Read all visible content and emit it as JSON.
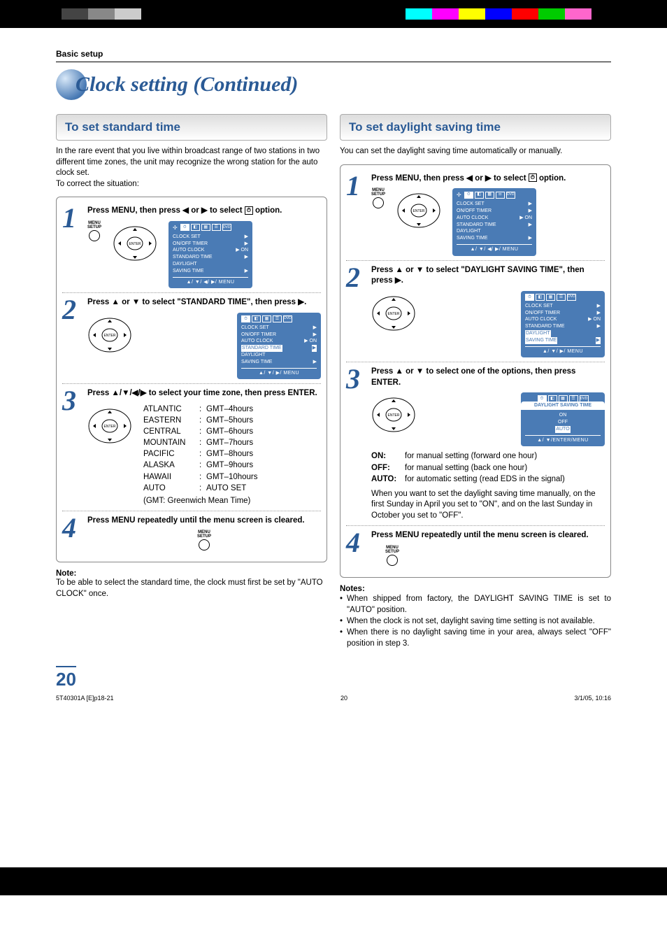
{
  "section_label": "Basic setup",
  "page_title": "Clock setting (Continued)",
  "page_number": "20",
  "footer": {
    "left": "5T40301A [E]p18-21",
    "center": "20",
    "right": "3/1/05, 10:16"
  },
  "left": {
    "subheading": "To set standard time",
    "intro": "In the rare event that you live within broadcast range of two stations in two different time zones, the unit may recognize the wrong station for the auto clock set.\nTo correct the situation:",
    "step1": {
      "instr_a": "Press MENU, then press ",
      "instr_b": " or ",
      "instr_c": " to select ",
      "instr_d": " option.",
      "menu_label": "MENU\nSETUP",
      "osd": {
        "rows": [
          [
            "CLOCK SET",
            "▶"
          ],
          [
            "ON/OFF TIMER",
            "▶"
          ],
          [
            "AUTO CLOCK",
            "▶ ON"
          ],
          [
            "STANDARD TIME",
            "▶"
          ],
          [
            "DAYLIGHT",
            ""
          ],
          [
            "      SAVING TIME",
            "▶"
          ]
        ],
        "foot": "▲/ ▼/ ◀/ ▶/ MENU"
      }
    },
    "step2": {
      "instr_a": "Press ",
      "instr_b": " or ",
      "instr_c": " to select \"STANDARD TIME\", then press ",
      "instr_d": ".",
      "osd": {
        "rows": [
          [
            "CLOCK SET",
            "▶"
          ],
          [
            "ON/OFF TIMER",
            "▶"
          ],
          [
            "AUTO CLOCK",
            "▶ ON"
          ],
          [
            "STANDARD TIME",
            "▶"
          ],
          [
            "DAYLIGHT",
            ""
          ],
          [
            "      SAVING TIME",
            "▶"
          ]
        ],
        "highlight_index": 3,
        "foot": "▲/ ▼/ ▶/ MENU"
      }
    },
    "step3": {
      "instr_a": "Press ",
      "instr_b": " to select your time zone, then press ENTER.",
      "tz": [
        [
          "ATLANTIC",
          "GMT–4hours"
        ],
        [
          "EASTERN",
          "GMT–5hours"
        ],
        [
          "CENTRAL",
          "GMT–6hours"
        ],
        [
          "MOUNTAIN",
          "GMT–7hours"
        ],
        [
          "PACIFIC",
          "GMT–8hours"
        ],
        [
          "ALASKA",
          "GMT–9hours"
        ],
        [
          "HAWAII",
          "GMT–10hours"
        ],
        [
          "AUTO",
          "AUTO SET"
        ]
      ],
      "tz_sub": "(GMT: Greenwich Mean Time)"
    },
    "step4": {
      "instr": "Press MENU repeatedly until the menu screen is cleared.",
      "menu_label": "MENU\nSETUP"
    },
    "note_head": "Note:",
    "note_body": "To be able to select the standard time, the clock must first be set by \"AUTO CLOCK\" once."
  },
  "right": {
    "subheading": "To set daylight saving time",
    "intro": "You can set the daylight saving time automatically or manually.",
    "step1": {
      "instr_a": "Press MENU, then press ",
      "instr_b": " or ",
      "instr_c": " to select ",
      "instr_d": " option.",
      "menu_label": "MENU\nSETUP",
      "osd": {
        "rows": [
          [
            "CLOCK SET",
            "▶"
          ],
          [
            "ON/OFF TIMER",
            "▶"
          ],
          [
            "AUTO CLOCK",
            "▶ ON"
          ],
          [
            "STANDARD TIME",
            "▶"
          ],
          [
            "DAYLIGHT",
            ""
          ],
          [
            "      SAVING TIME",
            "▶"
          ]
        ],
        "foot": "▲/ ▼/ ◀/ ▶/ MENU"
      }
    },
    "step2": {
      "instr_a": "Press ",
      "instr_b": " or ",
      "instr_c": " to select \"DAYLIGHT SAVING TIME\", then press ",
      "instr_d": ".",
      "osd": {
        "rows": [
          [
            "CLOCK SET",
            "▶"
          ],
          [
            "ON/OFF TIMER",
            "▶"
          ],
          [
            "AUTO CLOCK",
            "▶ ON"
          ],
          [
            "STANDARD TIME",
            "▶"
          ],
          [
            "DAYLIGHT",
            ""
          ],
          [
            "      SAVING TIME",
            "▶"
          ]
        ],
        "highlight_index": 4,
        "foot": "▲/ ▼/ ▶/ MENU"
      }
    },
    "step3": {
      "instr_a": "Press ",
      "instr_b": " or ",
      "instr_c": " to select one of the options, then press ENTER.",
      "osd": {
        "title": "DAYLIGHT SAVING TIME",
        "options": [
          "ON",
          "OFF",
          "AUTO"
        ],
        "highlight_index": 2,
        "foot": "▲/ ▼/ENTER/MENU"
      },
      "defs": [
        [
          "ON:",
          "for manual setting (forward one hour)"
        ],
        [
          "OFF:",
          "for manual setting (back one hour)"
        ],
        [
          "AUTO:",
          "for automatic setting (read EDS in the signal)"
        ]
      ],
      "para": "When you want to set the daylight saving time manually, on the first Sunday in April you set to \"ON\", and on the last Sunday in October you set to \"OFF\"."
    },
    "step4": {
      "instr": "Press MENU repeatedly until the menu screen is cleared.",
      "menu_label": "MENU\nSETUP"
    },
    "notes_head": "Notes:",
    "notes": [
      "When shipped from factory, the DAYLIGHT SAVING TIME is set to \"AUTO\" position.",
      "When the clock is not set, daylight saving time setting is not available.",
      "When there is no daylight saving time in your area, always select \"OFF\" position in step 3."
    ]
  }
}
